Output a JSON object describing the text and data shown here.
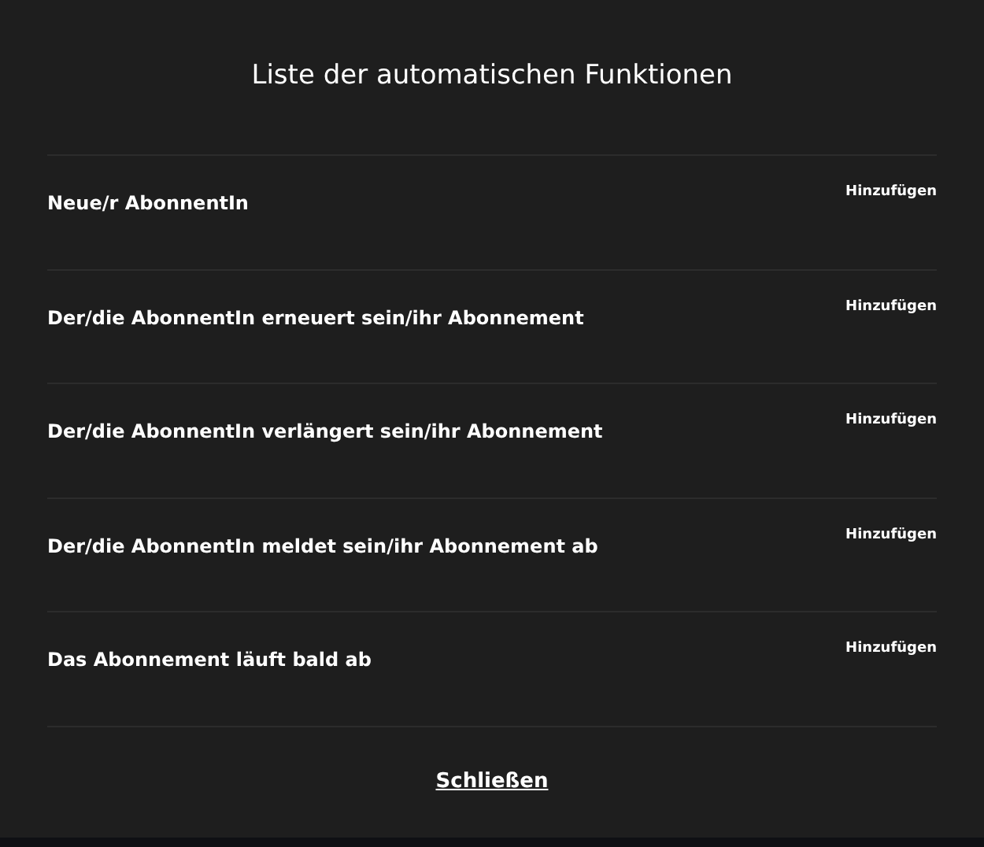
{
  "dialog": {
    "title": "Liste der automatischen Funktionen",
    "items": [
      {
        "label": "Neue/r AbonnentIn",
        "action": "Hinzufügen"
      },
      {
        "label": "Der/die AbonnentIn erneuert sein/ihr Abonnement",
        "action": "Hinzufügen"
      },
      {
        "label": "Der/die AbonnentIn verlängert sein/ihr Abonnement",
        "action": "Hinzufügen"
      },
      {
        "label": "Der/die AbonnentIn meldet sein/ihr Abonnement ab",
        "action": "Hinzufügen"
      },
      {
        "label": "Das Abonnement läuft bald ab",
        "action": "Hinzufügen"
      }
    ],
    "close": "Schließen"
  }
}
